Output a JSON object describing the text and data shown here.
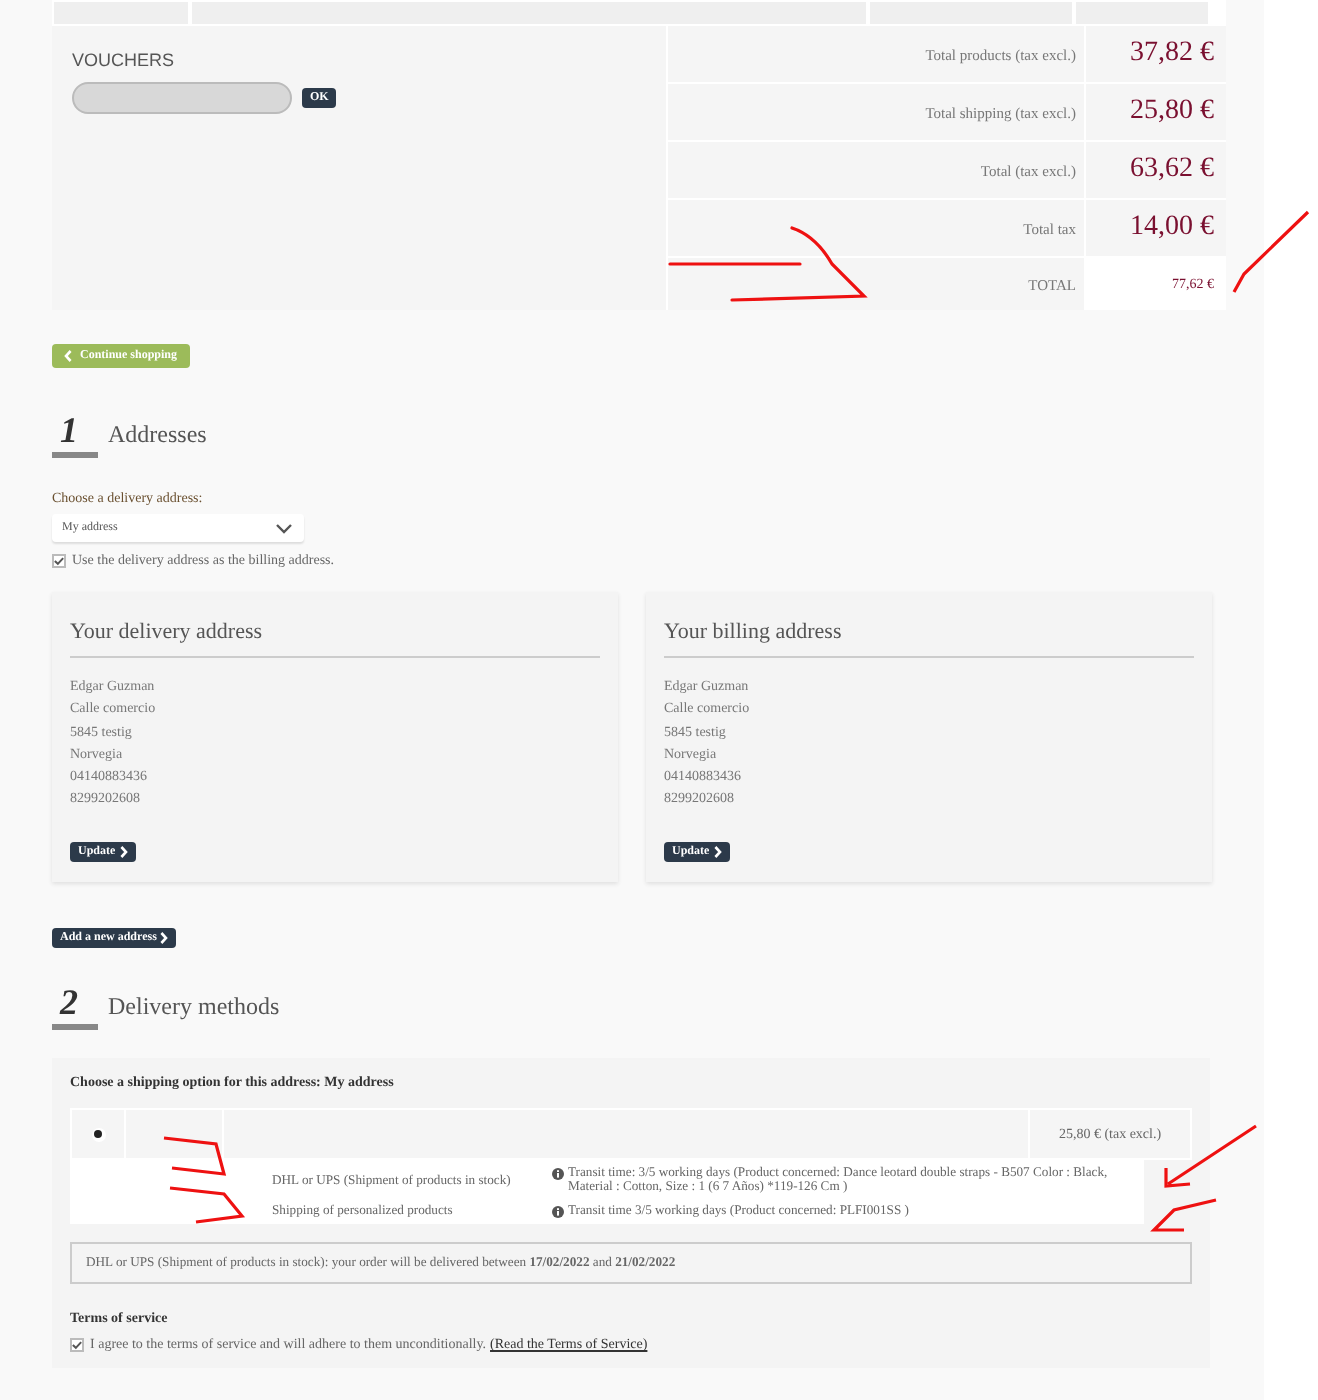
{
  "vouchers": {
    "title": "VOUCHERS",
    "button": "OK"
  },
  "totals": [
    {
      "label": "Total products (tax excl.)",
      "value": "37,82 €",
      "kind": "line"
    },
    {
      "label": "Total shipping (tax excl.)",
      "value": "25,80 €",
      "kind": "line"
    },
    {
      "label": "Total (tax excl.)",
      "value": "63,62 €",
      "kind": "line"
    },
    {
      "label": "Total tax",
      "value": "14,00 €",
      "kind": "line"
    },
    {
      "label": "TOTAL",
      "value": "77,62 €",
      "kind": "grand"
    }
  ],
  "continue_button": "Continue shopping",
  "addresses": {
    "number": "1",
    "title": "Addresses",
    "choose_label": "Choose a delivery address:",
    "select_value": "My address",
    "same_billing": {
      "label": "Use the delivery address as the billing address.",
      "checked": true
    },
    "cards": [
      {
        "title": "Your delivery address",
        "lines": [
          "Edgar Guzman",
          "Calle comercio",
          "5845 testig",
          "Norvegia",
          "04140883436",
          "8299202608"
        ],
        "button": "Update"
      },
      {
        "title": "Your billing address",
        "lines": [
          "Edgar Guzman",
          "Calle comercio",
          "5845 testig",
          "Norvegia",
          "04140883436",
          "8299202608"
        ],
        "button": "Update"
      }
    ],
    "add_button": "Add a new address"
  },
  "delivery": {
    "number": "2",
    "title": "Delivery methods",
    "prompt": "Choose a shipping option for this address: My address",
    "option": {
      "selected": true,
      "price": "25,80 € (tax excl.)",
      "carriers": [
        {
          "name": "DHL or UPS (Shipment of products in stock)",
          "info": "Transit time: 3/5 working days (Product concerned: Dance leotard double straps - B507 Color : Black, Material : Cotton, Size : 1 (6 7 Años) *119-126 Cm )"
        },
        {
          "name": "Shipping of personalized products",
          "info": "Transit time 3/5 working days (Product concerned: PLFI001SS )"
        }
      ]
    },
    "notice": "DHL or UPS (Shipment of products in stock): your order will be delivered between **17/02/2022** and **21/02/2022**",
    "terms": {
      "title": "Terms of service",
      "checked": true,
      "label": "I agree to the terms of service and will adhere to them unconditionally.",
      "link": "(Read the Terms of Service)"
    }
  }
}
